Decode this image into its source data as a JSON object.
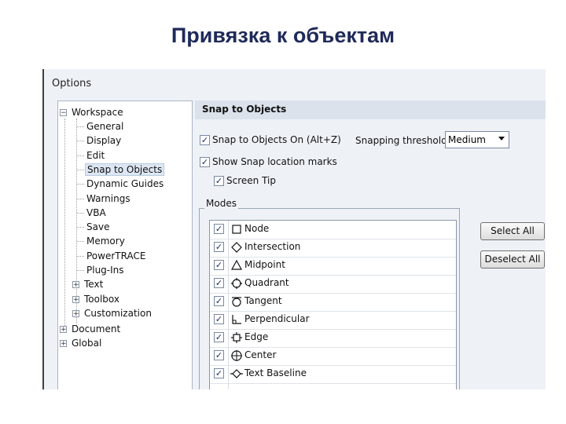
{
  "slide": {
    "title": "Привязка к объектам"
  },
  "window": {
    "title": "Options"
  },
  "tree": {
    "workspace": "Workspace",
    "workspace_children": [
      "General",
      "Display",
      "Edit",
      "Snap to Objects",
      "Dynamic Guides",
      "Warnings",
      "VBA",
      "Save",
      "Memory",
      "PowerTRACE",
      "Plug-Ins"
    ],
    "workspace_collapsed_children": [
      "Text",
      "Toolbox",
      "Customization"
    ],
    "document": "Document",
    "global": "Global",
    "selected": "Snap to Objects"
  },
  "panel": {
    "header": "Snap to Objects",
    "snap_on_label": "Snap to Objects On (Alt+Z)",
    "snap_on_checked": true,
    "threshold_label": "Snapping threshold",
    "threshold_value": "Medium",
    "show_marks_label": "Show Snap location marks",
    "show_marks_checked": true,
    "screen_tip_label": "Screen Tip",
    "screen_tip_checked": true,
    "modes_label": "Modes",
    "modes": [
      {
        "label": "Node",
        "icon": "square-icon",
        "checked": true
      },
      {
        "label": "Intersection",
        "icon": "diamond-icon",
        "checked": true
      },
      {
        "label": "Midpoint",
        "icon": "triangle-icon",
        "checked": true
      },
      {
        "label": "Quadrant",
        "icon": "quadrant-circle-icon",
        "checked": true
      },
      {
        "label": "Tangent",
        "icon": "tangent-circle-icon",
        "checked": true
      },
      {
        "label": "Perpendicular",
        "icon": "perpendicular-icon",
        "checked": true
      },
      {
        "label": "Edge",
        "icon": "edge-icon",
        "checked": true
      },
      {
        "label": "Center",
        "icon": "center-icon",
        "checked": true
      },
      {
        "label": "Text Baseline",
        "icon": "text-baseline-icon",
        "checked": true
      }
    ],
    "select_all": "Select All",
    "deselect_all": "Deselect All"
  },
  "colors": {
    "title": "#1f2a5a",
    "panel_bg": "#eef2f7",
    "header_bg": "#dbe2eb",
    "selection": "#dde7f3"
  }
}
